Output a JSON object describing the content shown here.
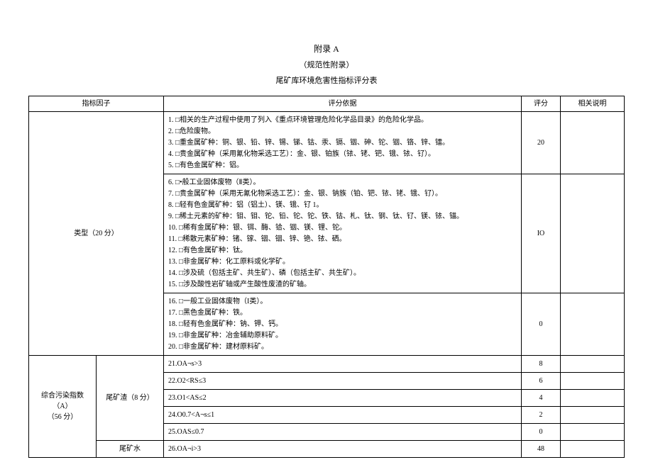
{
  "header": {
    "appendix": "附录 A",
    "subtitle": "（规范性附录）",
    "tableTitle": "尾矿库环境危害性指标评分表"
  },
  "columns": {
    "factor": "指标因子",
    "basis": "评分依据",
    "score": "评分",
    "note": "相关说明"
  },
  "rows": [
    {
      "factorA": "类型（20 分）",
      "factorArowspan": 3,
      "factorB": "",
      "basis": [
        "1. □相关的生产过程中使用了列入《重点环境管理危险化学品目录》的危险化学品。",
        "2. □危险废物。",
        "3. □重金属矿种：铜、银、铅、锌、锡、锑、钴、汞、镉、铟、砷、铊、铟、铬、锌、镭。",
        "4. □贵金属矿种（采用氰化物采选工艺）：金、银、铂族（铱、铑、钯、锇、铱、钌）。",
        "5. □有色金属矿种：铝。"
      ],
      "score": "20",
      "note": ""
    },
    {
      "factorA": "",
      "factorB": "",
      "basis": [
        "6. □•般工业固体废物（Ⅱ类）。",
        "7. □贵金属矿种（采用无氰化物采选工艺）：金、银、钠族（铂、钯、铱、铑、锇、钌）。",
        "8. □轻有色金属矿种：铝（铝土）、镁、锇、钌 1。",
        "9. □稀土元素的矿种：钼、钼、铊、铅、铊、铊、铁、钴、札、钛、钢、钛、钌、镁、铱、锚。",
        "10. □稀有金属矿种：银、铒、酶、铪、铟、镁、锂、铊。",
        "11. □稀散元素矿种：锗、镓、铟、铟、锌、铯、铱、硒。",
        "12. □有色金属矿种：钛。",
        "13. □非金属矿种：化工原料或化学矿。",
        "14. □涉及硫（包括主矿、共生矿）、磷（包括主矿、共生矿）。",
        "15. □涉及酸性岩矿轴或产生酸性废渣的矿轴。"
      ],
      "score": "IO",
      "note": ""
    },
    {
      "factorA": "",
      "factorB": "",
      "basis": [
        "16. □一般工业固体废物（I类）。",
        "17. □黑色金属矿种：铁。",
        "18. □轻有色金属矿种：钠、钾、钙。",
        "19. □非金属矿种：冶金辅助原料矿。",
        "20. □非金属矿种：建材原料矿。"
      ],
      "score": "0",
      "note": ""
    },
    {
      "factorA": "综合污染指数（A）\n（56 分）",
      "factorArowspan": 6,
      "factorB": "尾矿渣（8 分）",
      "factorBrowspan": 5,
      "basis": [
        "21.OA¬s>3"
      ],
      "score": "8",
      "note": ""
    },
    {
      "basis": [
        "22.O2<RS≤3"
      ],
      "score": "6",
      "note": ""
    },
    {
      "basis": [
        "23.O1<AS≤2"
      ],
      "score": "4",
      "note": ""
    },
    {
      "basis": [
        "24.O0.7<A¬s≤1"
      ],
      "score": "2",
      "note": ""
    },
    {
      "basis": [
        "25.OAS≤0.7"
      ],
      "score": "0",
      "note": ""
    },
    {
      "factorB": "尾矿水",
      "factorBrowspan": 1,
      "basis": [
        "26.OA¬i>3"
      ],
      "score": "48",
      "note": ""
    }
  ]
}
